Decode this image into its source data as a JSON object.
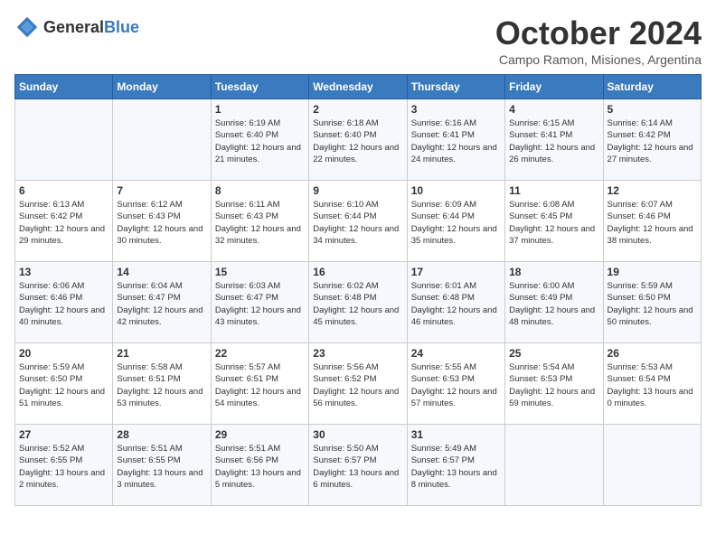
{
  "header": {
    "logo_general": "General",
    "logo_blue": "Blue",
    "title": "October 2024",
    "subtitle": "Campo Ramon, Misiones, Argentina"
  },
  "calendar": {
    "days_of_week": [
      "Sunday",
      "Monday",
      "Tuesday",
      "Wednesday",
      "Thursday",
      "Friday",
      "Saturday"
    ],
    "weeks": [
      [
        {
          "day": "",
          "detail": ""
        },
        {
          "day": "",
          "detail": ""
        },
        {
          "day": "1",
          "detail": "Sunrise: 6:19 AM\nSunset: 6:40 PM\nDaylight: 12 hours\nand 21 minutes."
        },
        {
          "day": "2",
          "detail": "Sunrise: 6:18 AM\nSunset: 6:40 PM\nDaylight: 12 hours\nand 22 minutes."
        },
        {
          "day": "3",
          "detail": "Sunrise: 6:16 AM\nSunset: 6:41 PM\nDaylight: 12 hours\nand 24 minutes."
        },
        {
          "day": "4",
          "detail": "Sunrise: 6:15 AM\nSunset: 6:41 PM\nDaylight: 12 hours\nand 26 minutes."
        },
        {
          "day": "5",
          "detail": "Sunrise: 6:14 AM\nSunset: 6:42 PM\nDaylight: 12 hours\nand 27 minutes."
        }
      ],
      [
        {
          "day": "6",
          "detail": "Sunrise: 6:13 AM\nSunset: 6:42 PM\nDaylight: 12 hours\nand 29 minutes."
        },
        {
          "day": "7",
          "detail": "Sunrise: 6:12 AM\nSunset: 6:43 PM\nDaylight: 12 hours\nand 30 minutes."
        },
        {
          "day": "8",
          "detail": "Sunrise: 6:11 AM\nSunset: 6:43 PM\nDaylight: 12 hours\nand 32 minutes."
        },
        {
          "day": "9",
          "detail": "Sunrise: 6:10 AM\nSunset: 6:44 PM\nDaylight: 12 hours\nand 34 minutes."
        },
        {
          "day": "10",
          "detail": "Sunrise: 6:09 AM\nSunset: 6:44 PM\nDaylight: 12 hours\nand 35 minutes."
        },
        {
          "day": "11",
          "detail": "Sunrise: 6:08 AM\nSunset: 6:45 PM\nDaylight: 12 hours\nand 37 minutes."
        },
        {
          "day": "12",
          "detail": "Sunrise: 6:07 AM\nSunset: 6:46 PM\nDaylight: 12 hours\nand 38 minutes."
        }
      ],
      [
        {
          "day": "13",
          "detail": "Sunrise: 6:06 AM\nSunset: 6:46 PM\nDaylight: 12 hours\nand 40 minutes."
        },
        {
          "day": "14",
          "detail": "Sunrise: 6:04 AM\nSunset: 6:47 PM\nDaylight: 12 hours\nand 42 minutes."
        },
        {
          "day": "15",
          "detail": "Sunrise: 6:03 AM\nSunset: 6:47 PM\nDaylight: 12 hours\nand 43 minutes."
        },
        {
          "day": "16",
          "detail": "Sunrise: 6:02 AM\nSunset: 6:48 PM\nDaylight: 12 hours\nand 45 minutes."
        },
        {
          "day": "17",
          "detail": "Sunrise: 6:01 AM\nSunset: 6:48 PM\nDaylight: 12 hours\nand 46 minutes."
        },
        {
          "day": "18",
          "detail": "Sunrise: 6:00 AM\nSunset: 6:49 PM\nDaylight: 12 hours\nand 48 minutes."
        },
        {
          "day": "19",
          "detail": "Sunrise: 5:59 AM\nSunset: 6:50 PM\nDaylight: 12 hours\nand 50 minutes."
        }
      ],
      [
        {
          "day": "20",
          "detail": "Sunrise: 5:59 AM\nSunset: 6:50 PM\nDaylight: 12 hours\nand 51 minutes."
        },
        {
          "day": "21",
          "detail": "Sunrise: 5:58 AM\nSunset: 6:51 PM\nDaylight: 12 hours\nand 53 minutes."
        },
        {
          "day": "22",
          "detail": "Sunrise: 5:57 AM\nSunset: 6:51 PM\nDaylight: 12 hours\nand 54 minutes."
        },
        {
          "day": "23",
          "detail": "Sunrise: 5:56 AM\nSunset: 6:52 PM\nDaylight: 12 hours\nand 56 minutes."
        },
        {
          "day": "24",
          "detail": "Sunrise: 5:55 AM\nSunset: 6:53 PM\nDaylight: 12 hours\nand 57 minutes."
        },
        {
          "day": "25",
          "detail": "Sunrise: 5:54 AM\nSunset: 6:53 PM\nDaylight: 12 hours\nand 59 minutes."
        },
        {
          "day": "26",
          "detail": "Sunrise: 5:53 AM\nSunset: 6:54 PM\nDaylight: 13 hours\nand 0 minutes."
        }
      ],
      [
        {
          "day": "27",
          "detail": "Sunrise: 5:52 AM\nSunset: 6:55 PM\nDaylight: 13 hours\nand 2 minutes."
        },
        {
          "day": "28",
          "detail": "Sunrise: 5:51 AM\nSunset: 6:55 PM\nDaylight: 13 hours\nand 3 minutes."
        },
        {
          "day": "29",
          "detail": "Sunrise: 5:51 AM\nSunset: 6:56 PM\nDaylight: 13 hours\nand 5 minutes."
        },
        {
          "day": "30",
          "detail": "Sunrise: 5:50 AM\nSunset: 6:57 PM\nDaylight: 13 hours\nand 6 minutes."
        },
        {
          "day": "31",
          "detail": "Sunrise: 5:49 AM\nSunset: 6:57 PM\nDaylight: 13 hours\nand 8 minutes."
        },
        {
          "day": "",
          "detail": ""
        },
        {
          "day": "",
          "detail": ""
        }
      ]
    ]
  }
}
